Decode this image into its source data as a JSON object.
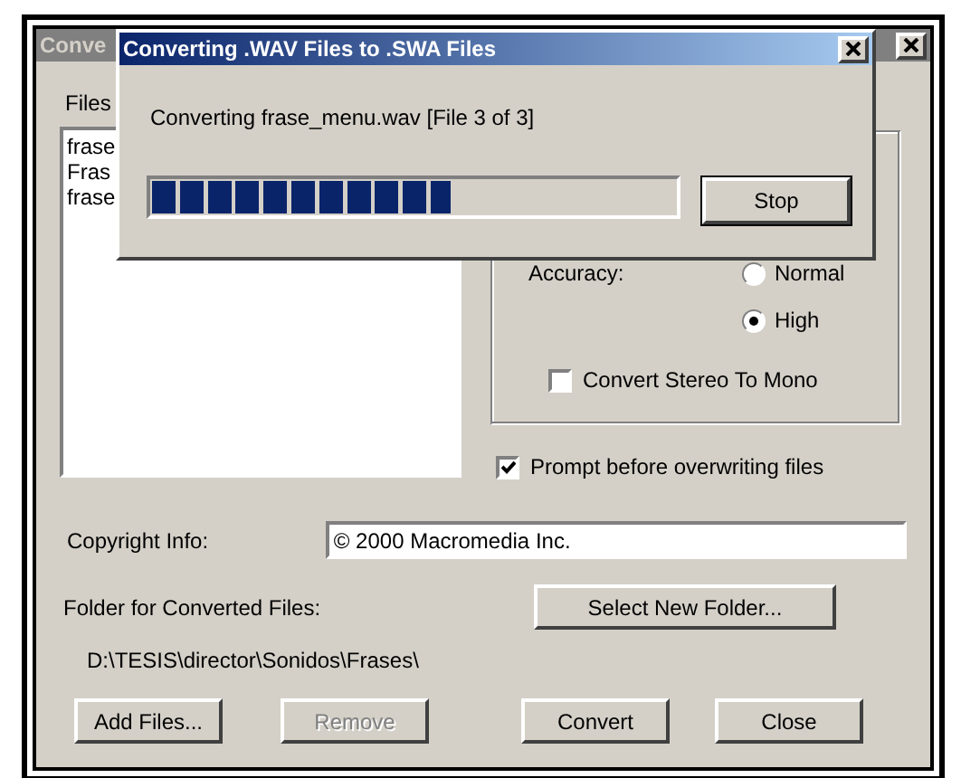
{
  "main_window": {
    "title": "Conve",
    "files_label": "Files",
    "files": [
      "frase",
      "Fras",
      "frase"
    ],
    "accuracy": {
      "label": "Accuracy:",
      "options": [
        {
          "label": "Normal",
          "selected": false
        },
        {
          "label": "High",
          "selected": true
        }
      ]
    },
    "stereo_to_mono": {
      "label": "Convert Stereo To Mono",
      "checked": false
    },
    "prompt_overwrite": {
      "label": "Prompt before overwriting files",
      "checked": true
    },
    "copyright": {
      "label": "Copyright Info:",
      "value": "© 2000 Macromedia Inc."
    },
    "folder": {
      "label": "Folder for Converted Files:",
      "button": "Select New Folder...",
      "path": "D:\\TESIS\\director\\Sonidos\\Frases\\"
    },
    "buttons": [
      {
        "label": "Add Files...",
        "disabled": false
      },
      {
        "label": "Remove",
        "disabled": true
      },
      {
        "label": "Convert",
        "disabled": false
      },
      {
        "label": "Close",
        "disabled": false
      }
    ]
  },
  "progress_dialog": {
    "title": "Converting .WAV Files to .SWA Files",
    "message": "Converting frase_menu.wav [File 3 of 3]",
    "progress": {
      "level": 0.57
    },
    "button": "Stop"
  }
}
